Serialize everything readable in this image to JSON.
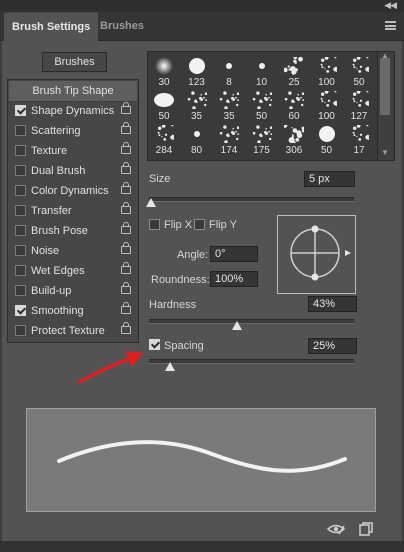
{
  "panel": {
    "collapse_glyph": "◀◀",
    "tabs": [
      {
        "label": "Brush Settings",
        "active": true
      },
      {
        "label": "Brushes",
        "active": false
      }
    ],
    "menu_icon": "hamburger-menu-icon"
  },
  "brushes_button": "Brushes",
  "settings_list": [
    {
      "label": "Brush Tip Shape",
      "header": true
    },
    {
      "label": "Shape Dynamics",
      "checked": true
    },
    {
      "label": "Scattering",
      "checked": false
    },
    {
      "label": "Texture",
      "checked": false
    },
    {
      "label": "Dual Brush",
      "checked": false
    },
    {
      "label": "Color Dynamics",
      "checked": false
    },
    {
      "label": "Transfer",
      "checked": false
    },
    {
      "label": "Brush Pose",
      "checked": false
    },
    {
      "label": "Noise",
      "checked": false
    },
    {
      "label": "Wet Edges",
      "checked": false
    },
    {
      "label": "Build-up",
      "checked": false
    },
    {
      "label": "Smoothing",
      "checked": true
    },
    {
      "label": "Protect Texture",
      "checked": false
    }
  ],
  "brush_presets": [
    {
      "size": "30",
      "kind": "soft"
    },
    {
      "size": "123",
      "kind": "hard"
    },
    {
      "size": "8",
      "kind": "speck"
    },
    {
      "size": "10",
      "kind": "speck"
    },
    {
      "size": "25",
      "kind": "splatter"
    },
    {
      "size": "100",
      "kind": "scatter"
    },
    {
      "size": "50",
      "kind": "scatter"
    },
    {
      "size": "50",
      "kind": "oval"
    },
    {
      "size": "35",
      "kind": "spray"
    },
    {
      "size": "35",
      "kind": "spray"
    },
    {
      "size": "50",
      "kind": "chalk"
    },
    {
      "size": "60",
      "kind": "chalk"
    },
    {
      "size": "100",
      "kind": "bristle"
    },
    {
      "size": "127",
      "kind": "bristle"
    },
    {
      "size": "284",
      "kind": "scatter"
    },
    {
      "size": "80",
      "kind": "speck"
    },
    {
      "size": "174",
      "kind": "grass"
    },
    {
      "size": "175",
      "kind": "grass"
    },
    {
      "size": "306",
      "kind": "leaf"
    },
    {
      "size": "50",
      "kind": "hard"
    },
    {
      "size": "17",
      "kind": "scatter"
    }
  ],
  "size": {
    "label": "Size",
    "value": "5 px",
    "fraction": 0.01
  },
  "flip_x": {
    "label": "Flip X",
    "checked": false
  },
  "flip_y": {
    "label": "Flip Y",
    "checked": false
  },
  "angle": {
    "label": "Angle:",
    "value": "0°"
  },
  "roundness": {
    "label": "Roundness:",
    "value": "100%"
  },
  "hardness": {
    "label": "Hardness",
    "value": "43%",
    "fraction": 0.43
  },
  "spacing": {
    "label": "Spacing",
    "value": "25%",
    "checked": true,
    "fraction": 0.1
  },
  "footer": {
    "icons": [
      "eye-visibility-icon",
      "new-preset-icon"
    ]
  },
  "colors": {
    "panel": "#535353",
    "annotation_arrow": "#e02020"
  }
}
